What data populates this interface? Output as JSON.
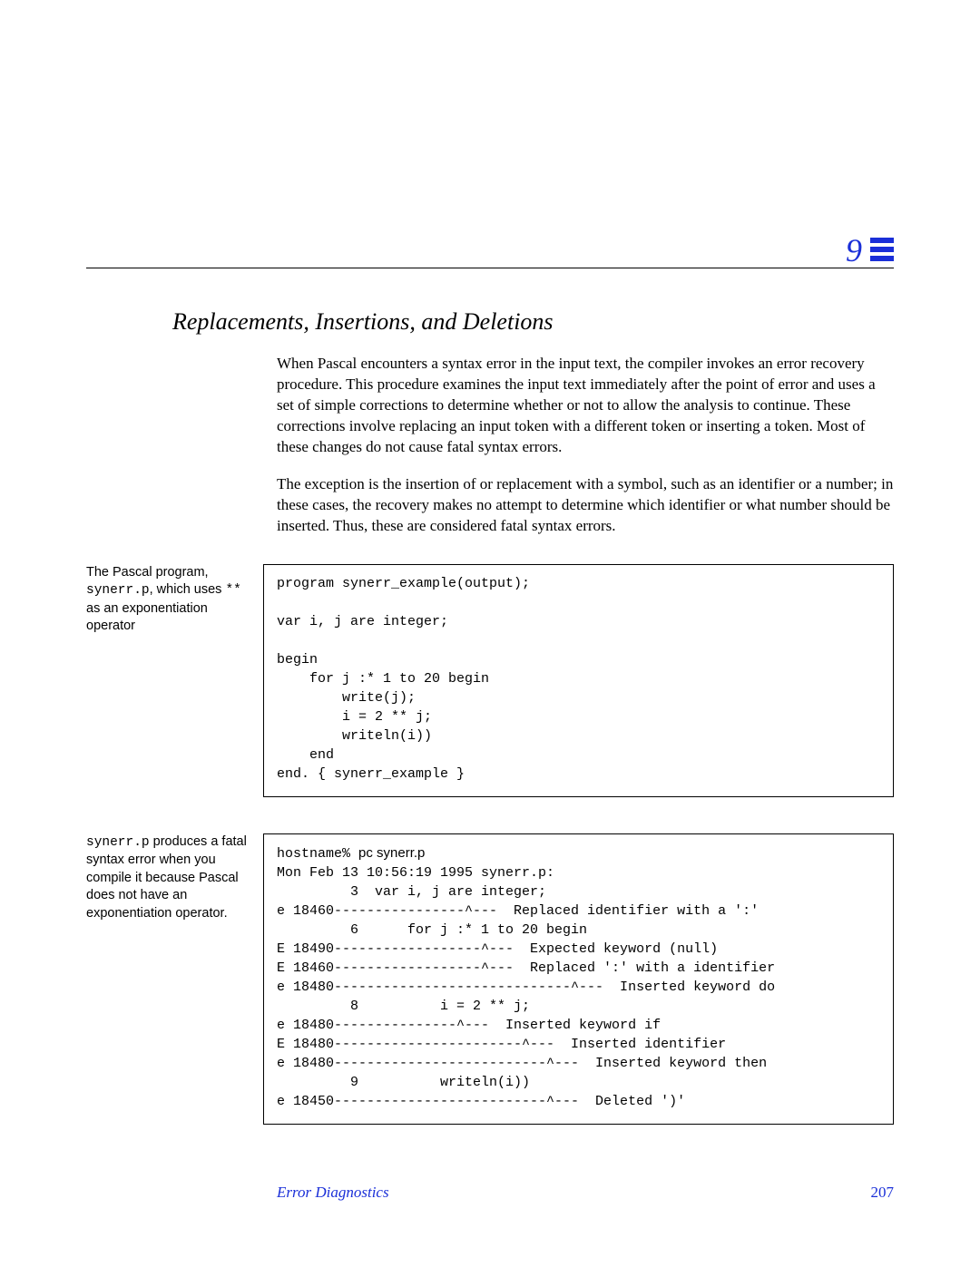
{
  "chapter_number": "9",
  "section_title": "Replacements, Insertions, and Deletions",
  "para1": "When Pascal encounters a syntax error in the input text, the compiler invokes an error recovery procedure.  This procedure examines the input text immediately after the point of error and uses a set of simple corrections to determine whether or not to allow the analysis to continue.  These corrections involve replacing an input token with a different token or inserting a token. Most of these changes do not cause fatal syntax errors.",
  "para2": "The exception is the insertion of or replacement with a symbol, such as an identifier or a number; in these cases, the recovery makes no attempt to determine which identifier or what number should be inserted.  Thus, these are considered fatal syntax errors.",
  "sidenote1_pre": "The Pascal  program, ",
  "sidenote1_mono1": "synerr.p",
  "sidenote1_mid": ", which uses ",
  "sidenote1_mono2": "**",
  "sidenote1_post": " as an exponentiation operator",
  "code1": "program synerr_example(output);\n\nvar i, j are integer;\n\nbegin\n    for j :* 1 to 20 begin\n        write(j);\n        i = 2 ** j;\n        writeln(i))\n    end\nend. { synerr_example }",
  "sidenote2_mono": "synerr.p",
  "sidenote2_rest": " produces a fatal syntax error when you compile it because Pascal  does not have an exponentiation operator.",
  "code2_prefix": "hostname% ",
  "code2_cmd": "pc synerr.p",
  "code2_body": "Mon Feb 13 10:56:19 1995 synerr.p:\n         3  var i, j are integer;\ne 18460----------------^---  Replaced identifier with a ':'\n         6      for j :* 1 to 20 begin\nE 18490------------------^---  Expected keyword (null)\nE 18460------------------^---  Replaced ':' with a identifier\ne 18480-----------------------------^---  Inserted keyword do\n         8          i = 2 ** j;\ne 18480---------------^---  Inserted keyword if\nE 18480-----------------------^---  Inserted identifier\ne 18480--------------------------^---  Inserted keyword then\n         9          writeln(i))\ne 18450--------------------------^---  Deleted ')'",
  "footer_title": "Error Diagnostics",
  "footer_page": "207"
}
